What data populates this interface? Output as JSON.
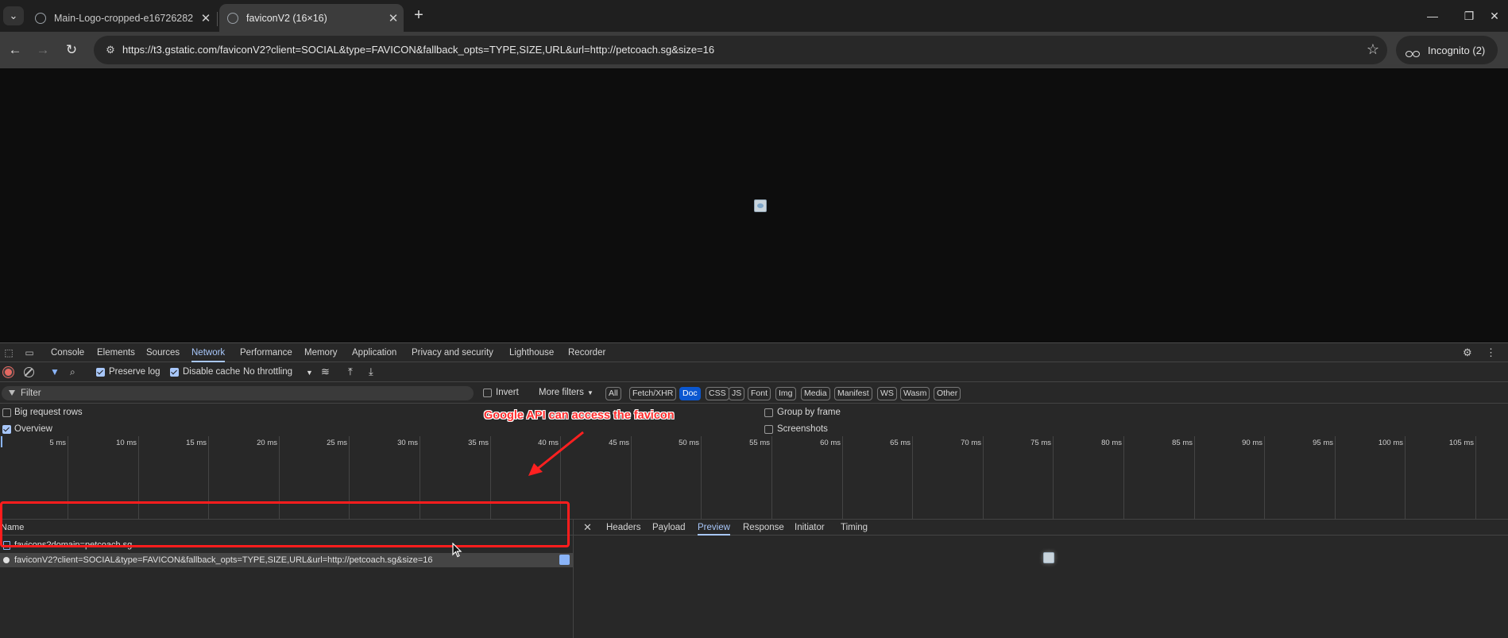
{
  "browser": {
    "tabs": [
      {
        "title": "Main-Logo-cropped-e16726282",
        "active": false
      },
      {
        "title": "faviconV2 (16×16)",
        "active": true
      }
    ],
    "url": "https://t3.gstatic.com/faviconV2?client=SOCIAL&type=FAVICON&fallback_opts=TYPE,SIZE,URL&url=http://petcoach.sg&size=16",
    "incognito_label": "Incognito (2)"
  },
  "devtools": {
    "tabs": [
      "Console",
      "Elements",
      "Sources",
      "Network",
      "Performance",
      "Memory",
      "Application",
      "Privacy and security",
      "Lighthouse",
      "Recorder"
    ],
    "active_tab": "Network",
    "toolbar": {
      "preserve_log": "Preserve log",
      "disable_cache": "Disable cache",
      "throttling": "No throttling"
    },
    "filter": {
      "placeholder": "Filter",
      "invert": "Invert",
      "more_filters": "More filters",
      "types": [
        "All",
        "Fetch/XHR",
        "Doc",
        "CSS",
        "JS",
        "Font",
        "Img",
        "Media",
        "Manifest",
        "WS",
        "Wasm",
        "Other"
      ],
      "active_type": "Doc"
    },
    "options": {
      "big_request_rows": "Big request rows",
      "overview": "Overview",
      "group_by_frame": "Group by frame",
      "screenshots": "Screenshots"
    },
    "timeline_labels": [
      "5 ms",
      "10 ms",
      "15 ms",
      "20 ms",
      "25 ms",
      "30 ms",
      "35 ms",
      "40 ms",
      "45 ms",
      "50 ms",
      "55 ms",
      "60 ms",
      "65 ms",
      "70 ms",
      "75 ms",
      "80 ms",
      "85 ms",
      "90 ms",
      "95 ms",
      "100 ms",
      "105 ms"
    ],
    "requests": {
      "column_name": "Name",
      "rows": [
        {
          "name": "favicons?domain=petcoach.sg",
          "type": "doc"
        },
        {
          "name": "faviconV2?client=SOCIAL&type=FAVICON&fallback_opts=TYPE,SIZE,URL&url=http://petcoach.sg&size=16",
          "type": "img",
          "selected": true
        }
      ]
    },
    "detail_tabs": [
      "Headers",
      "Payload",
      "Preview",
      "Response",
      "Initiator",
      "Timing"
    ],
    "active_detail_tab": "Preview"
  },
  "annotation": {
    "text": "Google API can access the favicon",
    "color": "#ff2b2b"
  }
}
